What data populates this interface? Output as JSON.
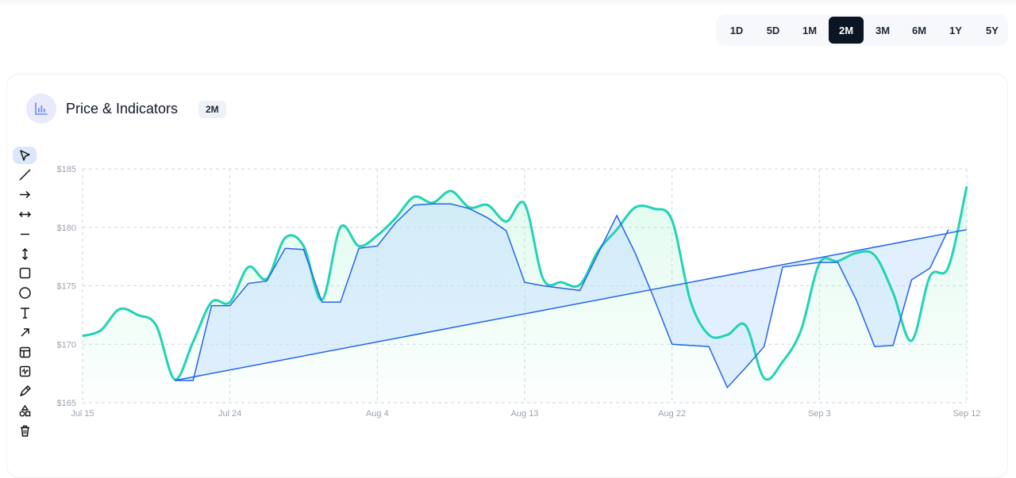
{
  "ranges": {
    "items": [
      "1D",
      "5D",
      "1M",
      "2M",
      "3M",
      "6M",
      "1Y",
      "5Y"
    ],
    "active": "2M"
  },
  "card": {
    "title": "Price & Indicators",
    "badge": "2M"
  },
  "toolbar": {
    "tools": [
      "cursor-icon",
      "trend-line-icon",
      "arrow-right-icon",
      "horizontal-arrows-icon",
      "horizontal-line-icon",
      "vertical-arrows-icon",
      "rectangle-icon",
      "circle-icon",
      "text-icon",
      "diagonal-arrow-icon",
      "layout-icon",
      "activity-icon",
      "brush-icon",
      "shapes-icon",
      "trash-icon"
    ],
    "active": "cursor-icon"
  },
  "chart_data": {
    "type": "line",
    "x_tick_labels": [
      "Jul 15",
      "Jul 24",
      "Aug 4",
      "Aug 13",
      "Aug 22",
      "Sep 3",
      "Sep 12"
    ],
    "y_tick_labels": [
      "$185",
      "$180",
      "$175",
      "$170",
      "$165"
    ],
    "ylim": [
      165,
      185
    ],
    "grid": true,
    "colors": {
      "price": "#22d3b4",
      "indicator": "#2563eb",
      "trend": "#2563eb",
      "fill_top": "#a7f3d0",
      "fill_blue": "#bfdbfe"
    },
    "series": [
      {
        "values": [
          170.7,
          171.2,
          173.0,
          172.5,
          171.6,
          167.0,
          170.2,
          173.6,
          173.6,
          176.6,
          175.6,
          179.1,
          178.4,
          173.8,
          180.0,
          178.4,
          179.3,
          180.8,
          182.6,
          182.1,
          183.1,
          181.7,
          181.9,
          180.5,
          182.0,
          175.6,
          175.3,
          175.1,
          178.0,
          179.8,
          181.7,
          181.6,
          180.6,
          173.7,
          170.8,
          170.8,
          171.6,
          167.1,
          168.5,
          171.2,
          176.9,
          177.1,
          177.8,
          177.6,
          174.4,
          170.3,
          175.8,
          176.6,
          183.5
        ]
      },
      {
        "values": [
          null,
          null,
          null,
          null,
          null,
          166.9,
          166.9,
          173.3,
          173.3,
          175.2,
          175.4,
          178.2,
          178.1,
          173.6,
          173.6,
          178.2,
          178.4,
          180.4,
          181.9,
          182.0,
          182.0,
          181.6,
          180.8,
          179.7,
          175.3,
          175.0,
          174.8,
          174.6,
          177.8,
          181.0,
          177.8,
          174.0,
          170.0,
          169.9,
          169.8,
          166.3,
          168.0,
          169.8,
          176.6,
          176.8,
          177.0,
          177.0,
          173.8,
          169.8,
          169.9,
          175.5,
          176.5,
          179.8
        ]
      }
    ],
    "trend_line": {
      "from": [
        5,
        166.9
      ],
      "to": [
        48,
        179.8
      ]
    }
  }
}
